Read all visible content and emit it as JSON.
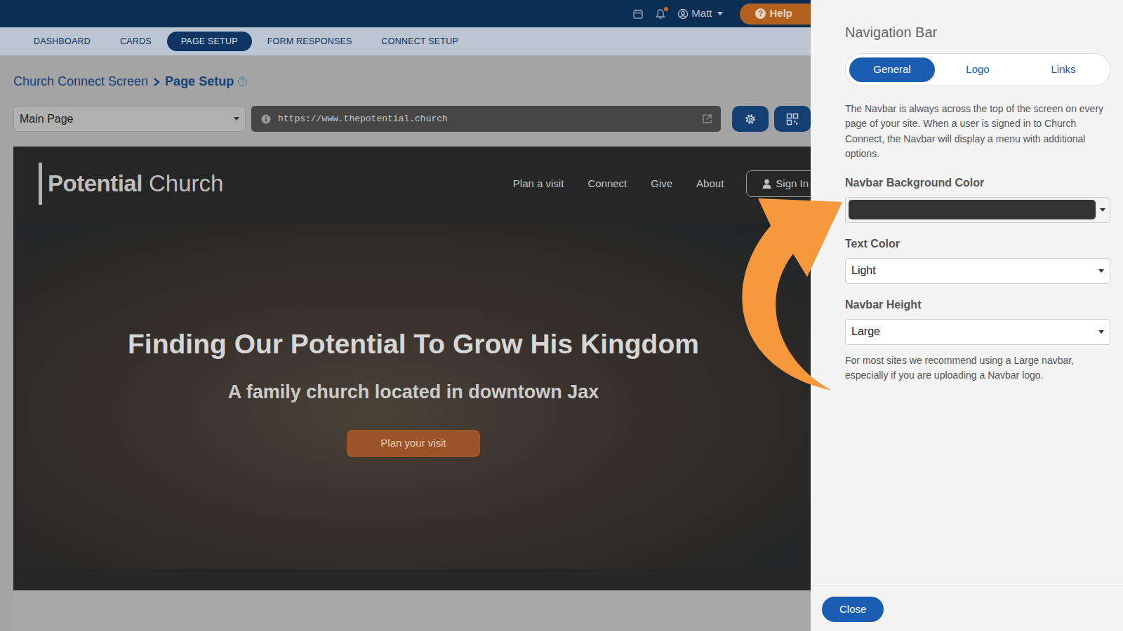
{
  "topbar": {
    "notification": true,
    "user": "Matt",
    "help_icon": "?",
    "help": "Help"
  },
  "tabs": [
    {
      "label": "DASHBOARD",
      "selected": false
    },
    {
      "label": "CARDS",
      "selected": false
    },
    {
      "label": "PAGE SETUP",
      "selected": true
    },
    {
      "label": "FORM RESPONSES",
      "selected": false
    },
    {
      "label": "CONNECT SETUP",
      "selected": false
    }
  ],
  "breadcrumb": {
    "parent": "Church Connect Screen",
    "current": "Page Setup",
    "help_icon": "?"
  },
  "page_select": {
    "value": "Main Page"
  },
  "url": {
    "value": "https://www.thepotential.church"
  },
  "preview": {
    "logo_bold": "Potential",
    "logo_light": "Church",
    "links": [
      "Plan a visit",
      "Connect",
      "Give",
      "About"
    ],
    "sign_in": "Sign In",
    "hero": {
      "title": "Finding Our Potential To Grow His Kingdom",
      "subtitle": "A family church located in downtown Jax",
      "button": "Plan your visit"
    }
  },
  "panel": {
    "title": "Navigation Bar",
    "tabs": [
      {
        "label": "General",
        "selected": true
      },
      {
        "label": "Logo",
        "selected": false
      },
      {
        "label": "Links",
        "selected": false
      }
    ],
    "description": "The Navbar is always across the top of the screen on every page of your site. When a user is signed in to Church Connect, the Navbar will display a menu with additional options.",
    "fields": [
      {
        "kind": "color",
        "label": "Navbar Background Color",
        "color": "#333333"
      },
      {
        "kind": "select",
        "label": "Text Color",
        "value": "Light"
      },
      {
        "kind": "select",
        "label": "Navbar Height",
        "value": "Large",
        "help": "For most sites we recommend using a Large navbar, especially if you are uploading a Navbar logo."
      }
    ],
    "close": "Close"
  }
}
